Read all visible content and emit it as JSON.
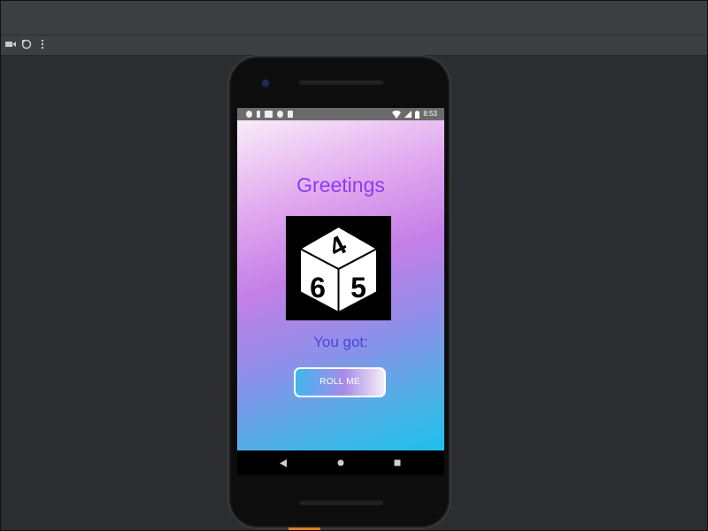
{
  "toolbar": {
    "icons": [
      "video-camera-icon",
      "rotate-icon",
      "more-vertical-icon"
    ]
  },
  "device": {
    "status_bar": {
      "time": "8:53",
      "left_icons": [
        "settings-icon",
        "sim-icon",
        "media-icon",
        "sync-icon",
        "sdcard-icon"
      ],
      "right_icons": [
        "wifi-icon",
        "signal-icon",
        "battery-icon"
      ]
    },
    "nav_bar": {
      "icons": [
        "back-icon",
        "home-icon",
        "recents-icon"
      ]
    }
  },
  "app": {
    "greeting": "Greetings",
    "dice_faces": {
      "top": "4",
      "left": "6",
      "right": "5"
    },
    "result_label": "You got:",
    "roll_button_label": "ROLL ME",
    "colors": {
      "greeting_text": "#8a3cf0",
      "result_text": "#4d44d9",
      "gradient_top": "#f8ecf8",
      "gradient_mid": "#c47fe7",
      "gradient_bottom": "#1cc0ec"
    }
  }
}
